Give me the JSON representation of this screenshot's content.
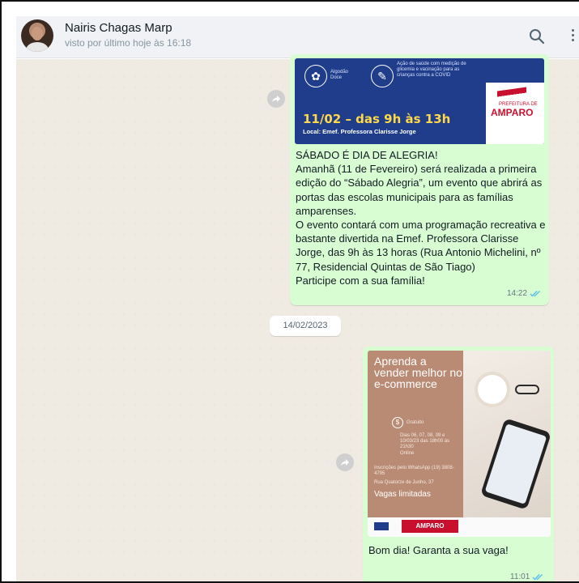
{
  "header": {
    "contact_name": "Nairis Chagas Marp",
    "last_seen": "visto por último hoje às 16:18"
  },
  "icons": {
    "search": "search-icon",
    "menu": "more-vertical-icon",
    "forward": "forward-icon",
    "read_receipt": "double-check-icon"
  },
  "colors": {
    "chat_background": "#efeae2",
    "outgoing_bubble": "#d9fdd3",
    "read_check": "#53bdeb",
    "flyer1_blue": "#1f3d8a",
    "flyer2_brown": "#b98b74",
    "brand_red": "#c8102e"
  },
  "messages": [
    {
      "flyer": {
        "item1": "Algodão Doce",
        "item2": "Ação de saúde com medição de glicemia e vacinação para as crianças contra a COVID",
        "date_line": "11/02 – das 9h às 13h",
        "local_line": "Local: Emef. Professora Clarisse Jorge",
        "logo_top": "PREFEITURA DE",
        "logo_name": "AMPARO"
      },
      "paragraphs": [
        "SÁBADO É DIA DE ALEGRIA!",
        "Amanhã (11 de Fevereiro) será realizada a primeira edição do “Sábado Alegria”, um evento que abrirá as portas das escolas municipais para as famílias amparenses.",
        "O evento contará com uma programação recreativa e bastante divertida na Emef. Professora Clarisse Jorge, das 9h às 13 horas (Rua Antonio Michelini, nº 77, Residencial Quintas de São Tiago)",
        "Participe com a sua família!"
      ],
      "time": "14:22"
    },
    {
      "flyer": {
        "headline": "Aprenda a vender melhor no e-commerce",
        "price": "Gratuito",
        "dates": "Dias 06, 07, 08, 09 e 10/03/23 das 18h00 às 21h30",
        "mode": "Online",
        "contact": "Inscrições pelo WhatsApp (19) 3808-4795",
        "address": "Rua Quatorze de Junho, 37",
        "vagas": "Vagas limitadas",
        "logo_name": "AMPARO"
      },
      "text": "Bom dia! Garanta a sua vaga!",
      "time": "11:01"
    }
  ],
  "date_separator": "14/02/2023"
}
